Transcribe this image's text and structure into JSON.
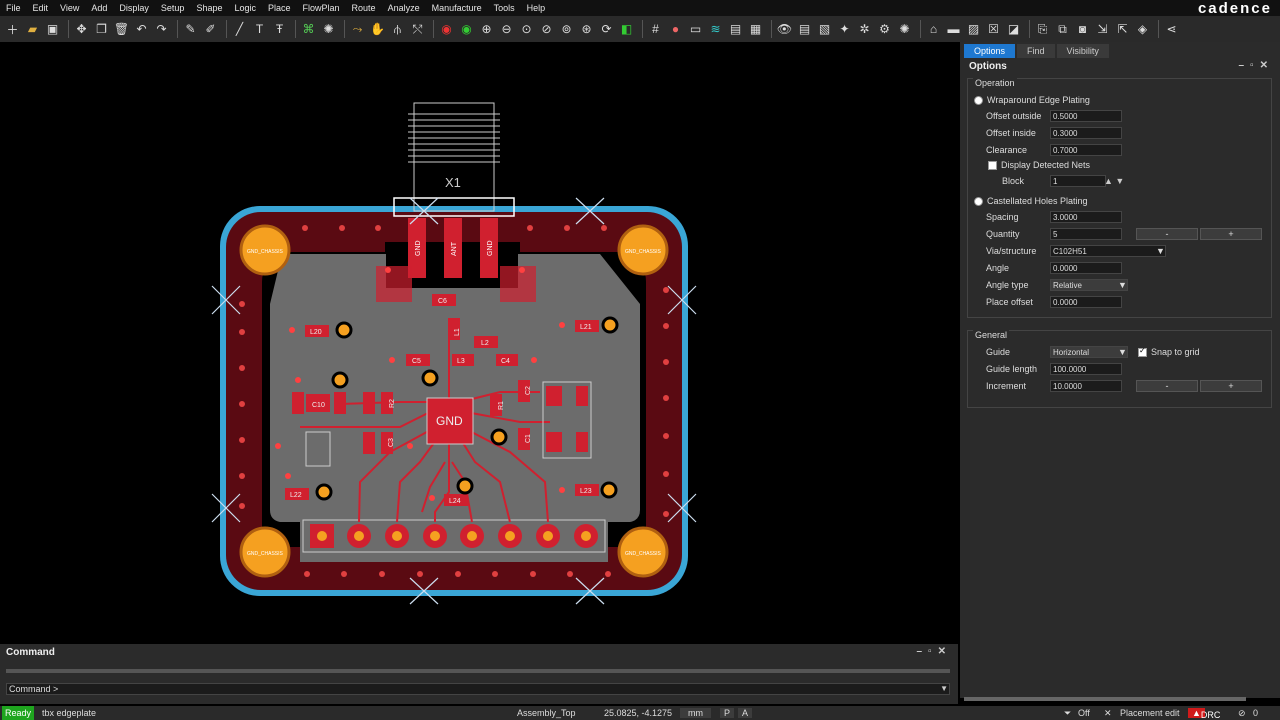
{
  "menu": [
    "File",
    "Edit",
    "View",
    "Add",
    "Display",
    "Setup",
    "Shape",
    "Logic",
    "Place",
    "FlowPlan",
    "Route",
    "Analyze",
    "Manufacture",
    "Tools",
    "Help"
  ],
  "brand": "cadence",
  "toolbar_icons": [
    "new-icon",
    "open-icon",
    "save-icon",
    "save-as-icon",
    "move-icon",
    "copy-icon",
    "delete-icon",
    "undo-icon",
    "redo-icon",
    "fix-icon",
    "unfix-icon",
    "line-icon",
    "text-icon",
    "text-edit-icon",
    "connect-icon",
    "slide-icon",
    "via-icon",
    "grid-icon",
    "zoom-in-icon",
    "zoom-out-icon",
    "zoom-fit-icon",
    "refresh-icon",
    "3d-icon",
    "color-icon",
    "visibility-icon",
    "settings-icon",
    "shape-icon",
    "drc-icon",
    "share-icon"
  ],
  "panel": {
    "tabs": [
      "Options",
      "Find",
      "Visibility"
    ],
    "title": "Options",
    "operation": {
      "label": "Operation",
      "wrap_label": "Wraparound Edge Plating",
      "offset_outside_label": "Offset outside",
      "offset_outside": "0.5000",
      "offset_inside_label": "Offset inside",
      "offset_inside": "0.3000",
      "clearance_label": "Clearance",
      "clearance": "0.7000",
      "display_nets_label": "Display Detected Nets",
      "block_label": "Block",
      "block": "1",
      "castellated_label": "Castellated Holes Plating",
      "spacing_label": "Spacing",
      "spacing": "3.0000",
      "quantity_label": "Quantity",
      "quantity": "5",
      "minus": "-",
      "plus": "+",
      "via_label": "Via/structure",
      "via": "C102H51",
      "angle_label": "Angle",
      "angle": "0.0000",
      "angle_type_label": "Angle type",
      "angle_type": "Relative",
      "place_offset_label": "Place offset",
      "place_offset": "0.0000"
    },
    "general": {
      "label": "General",
      "guide_label": "Guide",
      "guide": "Horizontal",
      "snap_label": "Snap to grid",
      "guide_length_label": "Guide length",
      "guide_length": "100.0000",
      "increment_label": "Increment",
      "increment": "10.0000"
    }
  },
  "board": {
    "connector_label": "X1",
    "center_label": "GND",
    "pad_labels": [
      "GND",
      "ANT",
      "GND"
    ],
    "refdes": [
      "C6",
      "L1",
      "L2",
      "C5",
      "L3",
      "C4",
      "C10",
      "R2",
      "R1",
      "C1",
      "C3",
      "C2",
      "L20",
      "L21",
      "L22",
      "L23",
      "L24"
    ],
    "chassis_label": "GND_CHASSIS"
  },
  "command": {
    "title": "Command",
    "prompt": "Command >"
  },
  "status": {
    "ready": "Ready",
    "tool": "tbx edgeplate",
    "subclass": "Assembly_Top",
    "coords": "25.0825, -4.1275",
    "units": "mm",
    "p": "P",
    "a": "A",
    "off": "Off",
    "mode": "Placement edit",
    "drc": "DRC",
    "count": "0"
  },
  "colors": {
    "board_dark": "#5a0a12",
    "copper": "#d0202f",
    "fill": "#6c6c6c",
    "edge": "#3aa6d6",
    "pad": "#f5a020"
  }
}
